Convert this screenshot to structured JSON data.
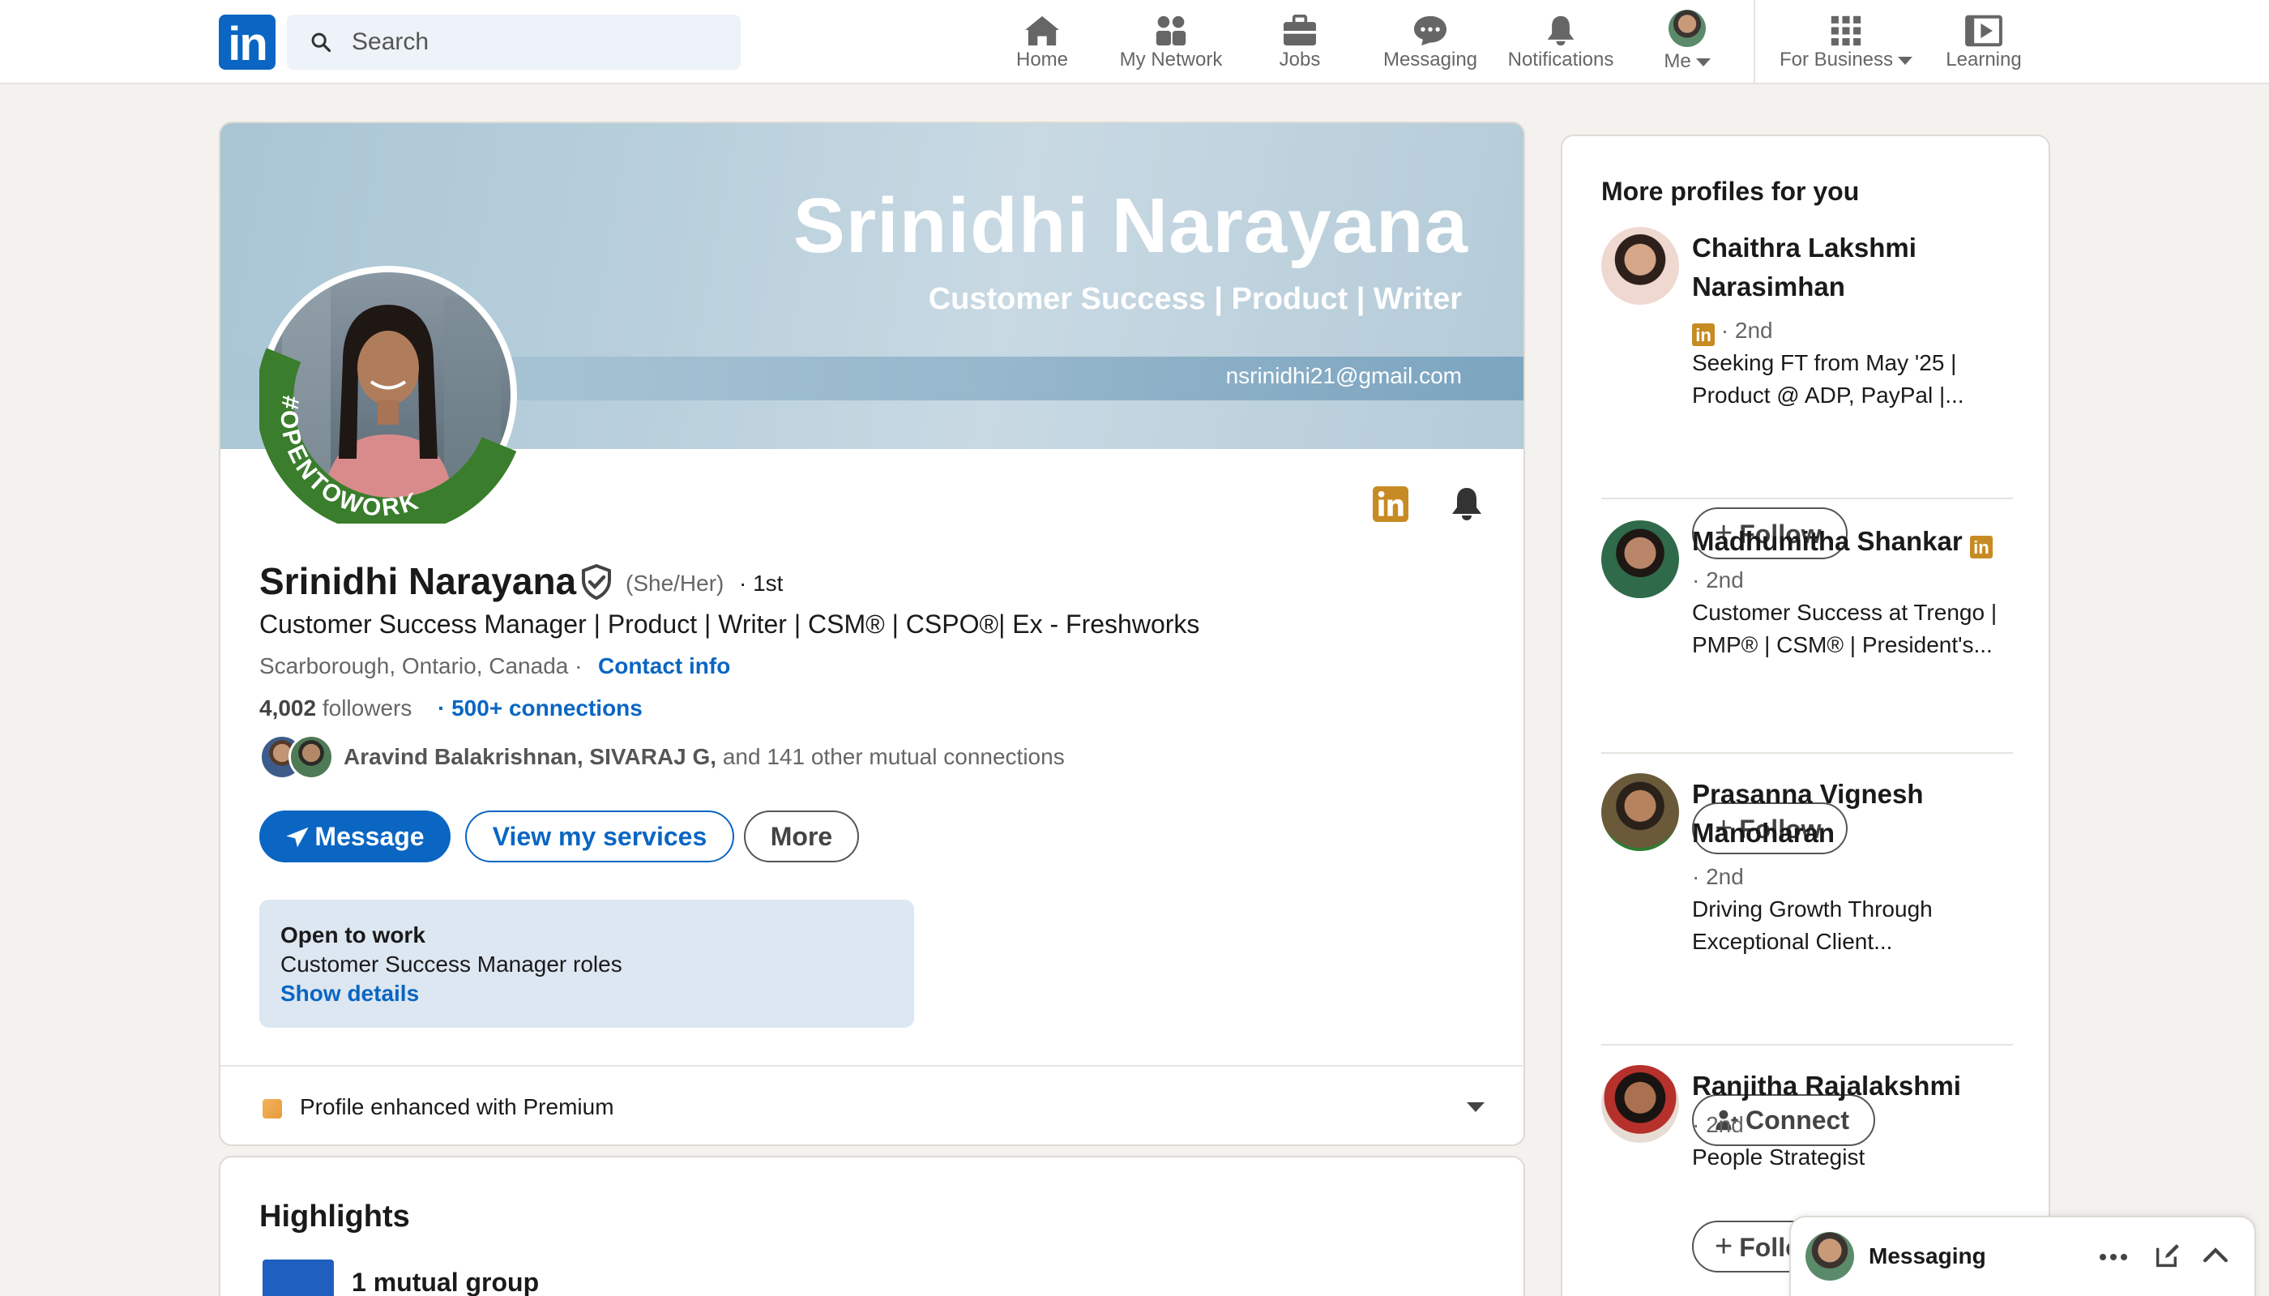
{
  "nav": {
    "logo": "in",
    "search_placeholder": "Search",
    "items": [
      {
        "label": "Home",
        "icon": "home-icon"
      },
      {
        "label": "My Network",
        "icon": "people-icon"
      },
      {
        "label": "Jobs",
        "icon": "briefcase-icon"
      },
      {
        "label": "Messaging",
        "icon": "chat-icon"
      },
      {
        "label": "Notifications",
        "icon": "bell-icon"
      },
      {
        "label": "Me",
        "icon": "avatar"
      },
      {
        "label": "For Business",
        "icon": "grid-icon"
      },
      {
        "label": "Learning",
        "icon": "play-icon"
      }
    ]
  },
  "banner": {
    "name": "Srinidhi Narayana",
    "tagline": "Customer Success | Product | Writer",
    "email": "nsrinidhi21@gmail.com"
  },
  "profile": {
    "name": "Srinidhi Narayana",
    "pronouns": "(She/Her)",
    "degree": "· 1st",
    "headline": "Customer Success Manager | Product | Writer | CSM® | CSPO®| Ex - Freshworks",
    "location": "Scarborough, Ontario, Canada ·",
    "contact_link": "Contact info",
    "followers_count": "4,002",
    "followers_label": "followers",
    "connections": "· 500+ connections",
    "mutual_names": "Aravind Balakrishnan, SIVARAJ G,",
    "mutual_rest": "and 141 other mutual connections",
    "otw_ring_text": "#OPENTOWORK"
  },
  "actions": {
    "message": "Message",
    "services": "View my services",
    "more": "More"
  },
  "open_to_work": {
    "title": "Open to work",
    "roles": "Customer Success Manager roles",
    "link": "Show details"
  },
  "premium": {
    "text": "Profile enhanced with Premium"
  },
  "highlights": {
    "title": "Highlights",
    "item": "1 mutual group"
  },
  "sidebar": {
    "title": "More profiles for you",
    "profiles": [
      {
        "name": "Chaithra Lakshmi Narasimhan",
        "degree": "· 2nd",
        "headline": "Seeking FT from May '25 | Product @ ADP, PayPal |...",
        "action": "Follow"
      },
      {
        "name": "Madhumitha Shankar",
        "degree": "· 2nd",
        "headline": "Customer Success at Trengo | PMP® | CSM® | President's...",
        "action": "Follow"
      },
      {
        "name": "Prasanna Vignesh Manoharan",
        "degree": "· 2nd",
        "headline": "Driving Growth Through Exceptional Client...",
        "action": "Connect"
      },
      {
        "name": "Ranjitha Rajalakshmi",
        "degree": "· 2nd",
        "headline": "People Strategist",
        "action": "Follow"
      }
    ]
  },
  "messaging_dock": {
    "label": "Messaging"
  },
  "colors": {
    "brand": "#0a66c2",
    "open_to_work_green": "#2e7d32",
    "premium_gold": "#c78b23",
    "page_bg": "#f4f2ee"
  }
}
